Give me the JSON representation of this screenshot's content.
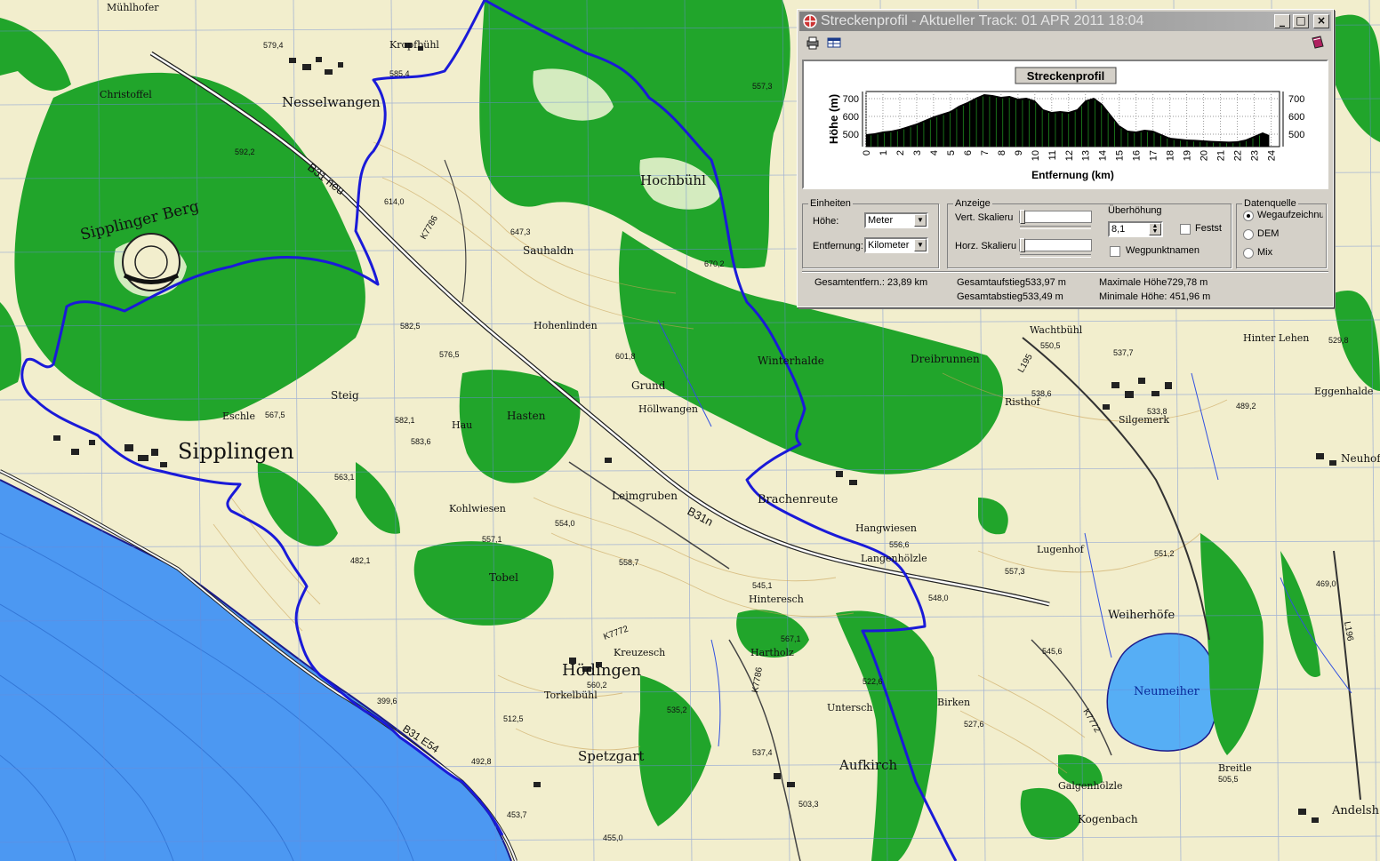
{
  "window": {
    "title": "Streckenprofil - Aktueller Track: 01 APR 2011 18:04",
    "minimize_label": "_",
    "maximize_label": "□",
    "close_label": "×"
  },
  "toolbar": {
    "icons": [
      "printer-icon",
      "table-icon",
      "book-icon"
    ]
  },
  "chart_data": {
    "type": "area",
    "title": "Streckenprofil",
    "xlabel": "Entfernung (km)",
    "ylabel": "Höhe (m)",
    "xlim": [
      0,
      24.5
    ],
    "ylim": [
      430,
      740
    ],
    "x_ticks": [
      0,
      1,
      2,
      3,
      4,
      5,
      6,
      7,
      8,
      9,
      10,
      11,
      12,
      13,
      14,
      15,
      16,
      17,
      18,
      19,
      20,
      21,
      22,
      23,
      24
    ],
    "y_ticks": [
      500,
      600,
      700
    ],
    "grid": true,
    "series": [
      {
        "x": [
          0,
          0.5,
          1,
          1.5,
          2,
          2.5,
          3,
          3.5,
          4,
          4.5,
          5,
          5.5,
          6,
          6.5,
          7,
          7.5,
          8,
          8.5,
          9,
          9.5,
          10,
          10.5,
          11,
          11.5,
          12,
          12.5,
          13,
          13.5,
          14,
          14.5,
          15,
          15.5,
          16,
          16.5,
          17,
          17.5,
          18,
          18.5,
          19,
          19.5,
          20,
          20.5,
          21,
          21.5,
          22,
          22.5,
          23,
          23.5,
          23.89
        ],
        "y": [
          500,
          505,
          515,
          520,
          530,
          545,
          560,
          580,
          600,
          615,
          630,
          660,
          680,
          705,
          725,
          720,
          710,
          715,
          700,
          705,
          690,
          640,
          625,
          630,
          625,
          640,
          690,
          705,
          670,
          610,
          550,
          520,
          515,
          525,
          520,
          500,
          480,
          475,
          470,
          468,
          465,
          462,
          460,
          458,
          460,
          470,
          490,
          510,
          495
        ]
      }
    ]
  },
  "units": {
    "group_label": "Einheiten",
    "height_label": "Höhe:",
    "height_value": "Meter",
    "distance_label": "Entfernung:",
    "distance_value": "Kilometer"
  },
  "display": {
    "group_label": "Anzeige",
    "vert_scale_label": "Vert. Skalieru",
    "horz_scale_label": "Horz. Skalieru",
    "exaggeration_label": "Überhöhung",
    "exaggeration_value": "8,1",
    "fixed_label": "Festst",
    "waypoint_names_label": "Wegpunktnamen"
  },
  "source": {
    "group_label": "Datenquelle",
    "options": [
      "Wegaufzeichnu",
      "DEM",
      "Mix"
    ],
    "selected": 0
  },
  "stats": {
    "total_distance": "Gesamtentfern.:  23,89 km",
    "total_ascent": "Gesamtaufstieg533,97 m",
    "total_descent": "Gesamtabstieg533,49 m",
    "max_height": "Maximale Höhe729,78 m",
    "min_height": "Minimale Höhe: 451,96 m"
  },
  "map": {
    "places": [
      "Nesselwangen",
      "Sipplingen",
      "Sipplinger Berg",
      "Hödingen",
      "Spetzgart",
      "Aufkirch",
      "Brachenreute",
      "Hochbühl",
      "Neumeiher",
      "Weiherhöfe",
      "Mühlhofer",
      "Kropfbühl",
      "Christoffel",
      "Hohenlinden",
      "Winterhalde",
      "Dreibrunnen",
      "Wachtbühl",
      "Grund",
      "Höllwangen",
      "Steig",
      "Eschle",
      "Hau",
      "Hasten",
      "Kohlwiesen",
      "Tobel",
      "Leimgruben",
      "Risthof",
      "Silgemerk",
      "Hinter Lehen",
      "Eggenhalde",
      "Neuhof",
      "Birken",
      "Galgenhölzle",
      "Kogenbach",
      "Untersch",
      "Torkelbühl",
      "Hinteresch",
      "Hartholz",
      "Kreuzesch",
      "Langenhölzle",
      "Hangwiesen",
      "Lugenhof",
      "Andelsh",
      "Sauhaldn",
      "Breitle"
    ],
    "roads": [
      "B31 neu",
      "B31n",
      "B31 E54",
      "K7786",
      "K7772",
      "L195",
      "K7772",
      "K7786",
      "L196"
    ],
    "spot_heights": [
      "579,4",
      "585,4",
      "557,3",
      "592,2",
      "614,0",
      "647,3",
      "670,2",
      "601,8",
      "582,5",
      "576,5",
      "567,5",
      "582,1",
      "583,6",
      "563,1",
      "554,0",
      "557,1",
      "558,7",
      "545,1",
      "567,1",
      "522,6",
      "527,6",
      "537,4",
      "503,3",
      "535,2",
      "560,2",
      "556,6",
      "548,0",
      "557,3",
      "550,5",
      "537,7",
      "538,6",
      "533,8",
      "489,2",
      "529,8",
      "551,2",
      "545,6",
      "505,5",
      "469,0",
      "482,1",
      "512,5",
      "492,8",
      "455,0",
      "453,7",
      "399,6"
    ]
  }
}
